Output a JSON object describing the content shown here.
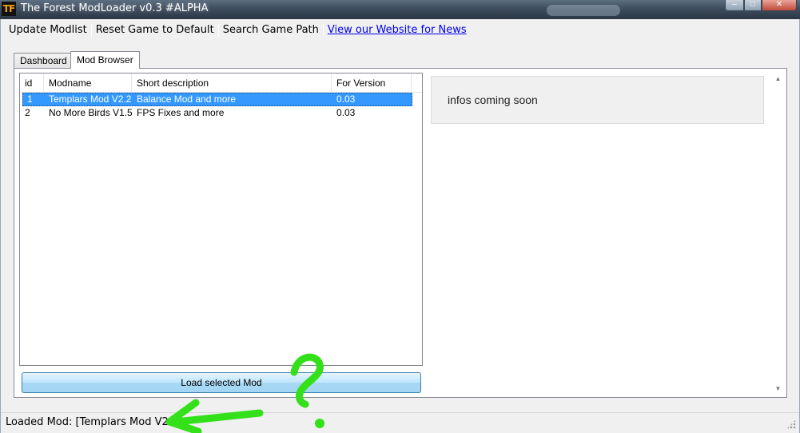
{
  "window": {
    "title": "The Forest ModLoader v0.3 #ALPHA",
    "icon_text": "TF",
    "controls": {
      "minimize": "–",
      "maximize": "□",
      "close": "✕"
    }
  },
  "menu": {
    "update_modlist": "Update Modlist",
    "reset_game": "Reset Game to Default",
    "search_game_path": "Search Game Path",
    "website_link": "View our Website for News"
  },
  "tabs": [
    {
      "label": "Dashboard",
      "active": false
    },
    {
      "label": "Mod Browser",
      "active": true
    }
  ],
  "mod_list": {
    "columns": [
      "id",
      "Modname",
      "Short description",
      "For Version"
    ],
    "rows": [
      {
        "id": "1",
        "name": "Templars Mod V2.2",
        "desc": "Balance Mod and more",
        "version": "0.03",
        "selected": true
      },
      {
        "id": "2",
        "name": "No More Birds V1.5",
        "desc": "FPS Fixes and more",
        "version": "0.03",
        "selected": false
      }
    ]
  },
  "load_button": "Load selected Mod",
  "info_text": "infos coming soon",
  "scrollbar": {
    "up": "▲",
    "down": "▼"
  },
  "status": {
    "text": "Loaded Mod:  [Templars Mod V2.2]"
  },
  "colors": {
    "selection": "#3399ff",
    "annotation": "#33e01a",
    "link": "#0000ee"
  }
}
